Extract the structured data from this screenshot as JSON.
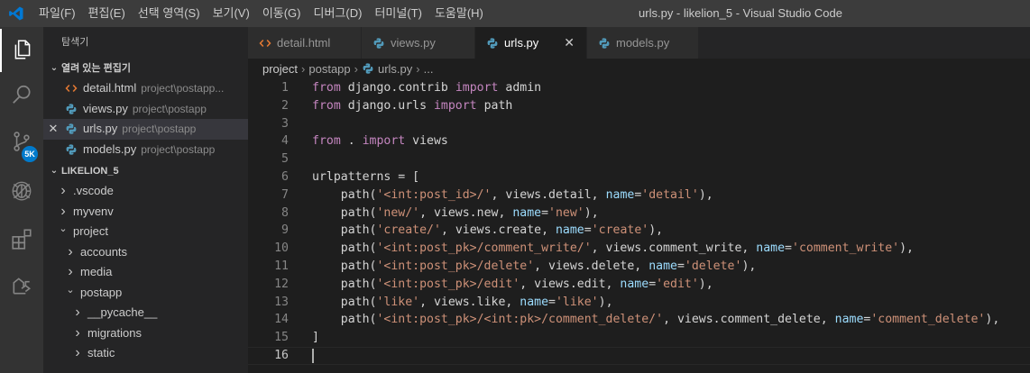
{
  "window": {
    "title": "urls.py - likelion_5 - Visual Studio Code"
  },
  "menubar": [
    "파일(F)",
    "편집(E)",
    "선택 영역(S)",
    "보기(V)",
    "이동(G)",
    "디버그(D)",
    "터미널(T)",
    "도움말(H)"
  ],
  "activity": {
    "scm_badge": "5K"
  },
  "sidebar": {
    "title": "탐색기",
    "open_editors": {
      "label": "열려 있는 편집기",
      "items": [
        {
          "name": "detail.html",
          "path": "project\\postapp...",
          "type": "html"
        },
        {
          "name": "views.py",
          "path": "project\\postapp",
          "type": "py"
        },
        {
          "name": "urls.py",
          "path": "project\\postapp",
          "type": "py"
        },
        {
          "name": "models.py",
          "path": "project\\postapp",
          "type": "py"
        }
      ]
    },
    "workspace": {
      "label": "LIKELION_5",
      "tree": [
        {
          "name": ".vscode",
          "expanded": false
        },
        {
          "name": "myvenv",
          "expanded": false
        },
        {
          "name": "project",
          "expanded": true
        },
        {
          "name": "accounts",
          "expanded": false
        },
        {
          "name": "media",
          "expanded": false
        },
        {
          "name": "postapp",
          "expanded": true
        },
        {
          "name": "__pycache__",
          "expanded": false
        },
        {
          "name": "migrations",
          "expanded": false
        },
        {
          "name": "static",
          "expanded": false
        }
      ]
    }
  },
  "tabs": [
    {
      "label": "detail.html",
      "type": "html"
    },
    {
      "label": "views.py",
      "type": "py"
    },
    {
      "label": "urls.py",
      "type": "py",
      "active": true
    },
    {
      "label": "models.py",
      "type": "py"
    }
  ],
  "breadcrumb": {
    "parts": [
      "project",
      "postapp",
      "urls.py",
      "..."
    ]
  },
  "editor": {
    "line_numbers": [
      "1",
      "2",
      "3",
      "4",
      "5",
      "6",
      "7",
      "8",
      "9",
      "10",
      "11",
      "12",
      "13",
      "14",
      "15",
      "16"
    ],
    "current_line": "16",
    "code": [
      [
        [
          "k",
          "from"
        ],
        [
          "d",
          " django.contrib "
        ],
        [
          "k",
          "import"
        ],
        [
          "d",
          " admin"
        ]
      ],
      [
        [
          "k",
          "from"
        ],
        [
          "d",
          " django.urls "
        ],
        [
          "k",
          "import"
        ],
        [
          "d",
          " path"
        ]
      ],
      [],
      [
        [
          "k",
          "from"
        ],
        [
          "d",
          " . "
        ],
        [
          "k",
          "import"
        ],
        [
          "d",
          " views"
        ]
      ],
      [],
      [
        [
          "d",
          "urlpatterns = ["
        ]
      ],
      [
        [
          "d",
          "    path("
        ],
        [
          "s",
          "'<int:post_id>/'"
        ],
        [
          "d",
          ", views.detail, "
        ],
        [
          "p",
          "name"
        ],
        [
          "d",
          "="
        ],
        [
          "s",
          "'detail'"
        ],
        [
          "d",
          "),"
        ]
      ],
      [
        [
          "d",
          "    path("
        ],
        [
          "s",
          "'new/'"
        ],
        [
          "d",
          ", views.new, "
        ],
        [
          "p",
          "name"
        ],
        [
          "d",
          "="
        ],
        [
          "s",
          "'new'"
        ],
        [
          "d",
          "),"
        ]
      ],
      [
        [
          "d",
          "    path("
        ],
        [
          "s",
          "'create/'"
        ],
        [
          "d",
          ", views.create, "
        ],
        [
          "p",
          "name"
        ],
        [
          "d",
          "="
        ],
        [
          "s",
          "'create'"
        ],
        [
          "d",
          "),"
        ]
      ],
      [
        [
          "d",
          "    path("
        ],
        [
          "s",
          "'<int:post_pk>/comment_write/'"
        ],
        [
          "d",
          ", views.comment_write, "
        ],
        [
          "p",
          "name"
        ],
        [
          "d",
          "="
        ],
        [
          "s",
          "'comment_write'"
        ],
        [
          "d",
          "),"
        ]
      ],
      [
        [
          "d",
          "    path("
        ],
        [
          "s",
          "'<int:post_pk>/delete'"
        ],
        [
          "d",
          ", views.delete, "
        ],
        [
          "p",
          "name"
        ],
        [
          "d",
          "="
        ],
        [
          "s",
          "'delete'"
        ],
        [
          "d",
          "),"
        ]
      ],
      [
        [
          "d",
          "    path("
        ],
        [
          "s",
          "'<int:post_pk>/edit'"
        ],
        [
          "d",
          ", views.edit, "
        ],
        [
          "p",
          "name"
        ],
        [
          "d",
          "="
        ],
        [
          "s",
          "'edit'"
        ],
        [
          "d",
          "),"
        ]
      ],
      [
        [
          "d",
          "    path("
        ],
        [
          "s",
          "'like'"
        ],
        [
          "d",
          ", views.like, "
        ],
        [
          "p",
          "name"
        ],
        [
          "d",
          "="
        ],
        [
          "s",
          "'like'"
        ],
        [
          "d",
          "),"
        ]
      ],
      [
        [
          "d",
          "    path("
        ],
        [
          "s",
          "'<int:post_pk>/<int:pk>/comment_delete/'"
        ],
        [
          "d",
          ", views.comment_delete, "
        ],
        [
          "p",
          "name"
        ],
        [
          "d",
          "="
        ],
        [
          "s",
          "'comment_delete'"
        ],
        [
          "d",
          "),"
        ]
      ],
      [
        [
          "d",
          "]"
        ]
      ],
      []
    ]
  },
  "colors": {
    "keyword": "#c586c0",
    "string": "#ce9178",
    "param": "#9cdcfe",
    "text": "#d4d4d4",
    "vscode_blue": "#0078d4",
    "python_blue": "#519aba",
    "html_orange": "#e37933"
  },
  "icons": {
    "vscode": "vscode-logo-icon",
    "explorer": "files-icon",
    "search": "search-icon",
    "scm": "source-control-icon",
    "debug": "debug-icon",
    "extensions": "extensions-icon",
    "remote": "live-share-icon",
    "python": "python-file-icon",
    "html": "html-file-icon"
  }
}
